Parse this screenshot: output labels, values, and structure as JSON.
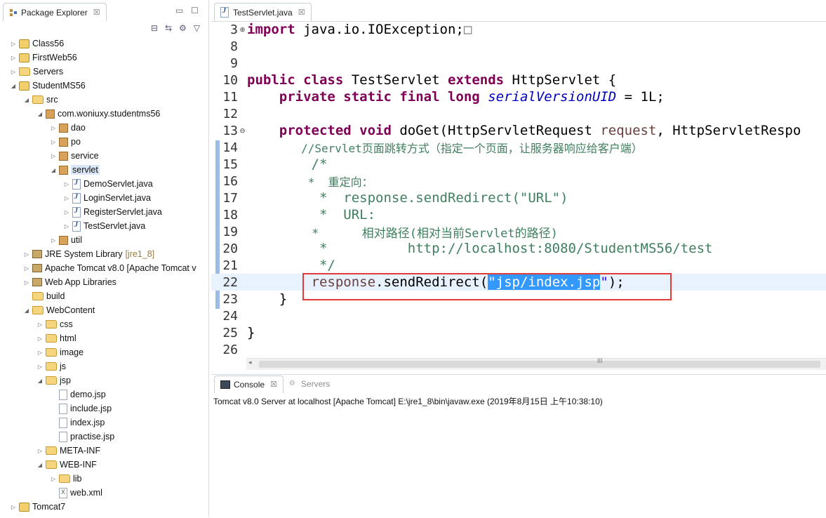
{
  "explorer": {
    "tab_label": "Package Explorer",
    "tab_close": "☒",
    "minimize": "▭",
    "maximize": "☐",
    "toolbar": {
      "collapse": "⊟",
      "link": "⇆",
      "filters": "⚙",
      "menu": "▽"
    },
    "tree": [
      {
        "label": "Class56"
      },
      {
        "label": "FirstWeb56"
      },
      {
        "label": "Servers"
      },
      {
        "label": "StudentMS56"
      },
      {
        "label": "src"
      },
      {
        "label": "com.woniuxy.studentms56"
      },
      {
        "label": "dao"
      },
      {
        "label": "po"
      },
      {
        "label": "service"
      },
      {
        "label": "servlet"
      },
      {
        "label": "DemoServlet.java"
      },
      {
        "label": "LoginServlet.java"
      },
      {
        "label": "RegisterServlet.java"
      },
      {
        "label": "TestServlet.java"
      },
      {
        "label": "util"
      },
      {
        "label": "JRE System Library",
        "deco": "[jre1_8]"
      },
      {
        "label": "Apache Tomcat v8.0 [Apache Tomcat v"
      },
      {
        "label": "Web App Libraries"
      },
      {
        "label": "build"
      },
      {
        "label": "WebContent"
      },
      {
        "label": "css"
      },
      {
        "label": "html"
      },
      {
        "label": "image"
      },
      {
        "label": "js"
      },
      {
        "label": "jsp"
      },
      {
        "label": "demo.jsp"
      },
      {
        "label": "include.jsp"
      },
      {
        "label": "index.jsp"
      },
      {
        "label": "practise.jsp"
      },
      {
        "label": "META-INF"
      },
      {
        "label": "WEB-INF"
      },
      {
        "label": "lib"
      },
      {
        "label": "web.xml"
      },
      {
        "label": "Tomcat7"
      }
    ]
  },
  "editor": {
    "tab_label": "TestServlet.java",
    "tab_close": "☒",
    "lines": {
      "l3": {
        "num": "3",
        "gutter": "⊕",
        "t1": "import",
        "t2": " java.io.IOException;",
        "t3": "□"
      },
      "l8": {
        "num": "8"
      },
      "l9": {
        "num": "9"
      },
      "l10": {
        "num": "10",
        "t1": "public class",
        "t2": " TestServlet ",
        "t3": "extends",
        "t4": " HttpServlet {"
      },
      "l11": {
        "num": "11",
        "t1": "    private static final long",
        "t2": " ",
        "t3": "serialVersionUID",
        "t4": " = 1L;"
      },
      "l12": {
        "num": "12"
      },
      "l13": {
        "num": "13",
        "gutter": "⊖",
        "t1": "    protected void",
        "t2": " doGet(HttpServletRequest ",
        "t3": "request",
        "t4": ", HttpServletRespo"
      },
      "l14": {
        "num": "14",
        "t1": "        //Servlet页面跳转方式（指定一个页面，让服务器响应给客户端）"
      },
      "l15": {
        "num": "15",
        "t1": "        /*"
      },
      "l16": {
        "num": "16",
        "t1": "         *  重定向："
      },
      "l17": {
        "num": "17",
        "t1": "         *  response.sendRedirect(\"URL\")"
      },
      "l18": {
        "num": "18",
        "t1": "         *  URL:"
      },
      "l19": {
        "num": "19",
        "t1": "         *      相对路径(相对当前Servlet的路径)"
      },
      "l20": {
        "num": "20",
        "t1": "         *          http://localhost:8080/StudentMS56/test"
      },
      "l21": {
        "num": "21",
        "t1": "         */"
      },
      "l22": {
        "num": "22",
        "t1": "        response",
        "t2": ".sendRedirect(",
        "t3": "\"",
        "t4": "jsp/index.jsp",
        "t5": "\"",
        "t6": ");"
      },
      "l23": {
        "num": "23",
        "t1": "    }"
      },
      "l24": {
        "num": "24"
      },
      "l25": {
        "num": "25",
        "t1": "}"
      },
      "l26": {
        "num": "26"
      }
    },
    "scroll_left": "◂",
    "scroll_grip": "III"
  },
  "console": {
    "tab_console": "Console",
    "tab_servers": "Servers",
    "tab_close": "☒",
    "status": "Tomcat v8.0 Server at localhost [Apache Tomcat] E:\\jre1_8\\bin\\javaw.exe (2019年8月15日 上午10:38:10)"
  }
}
